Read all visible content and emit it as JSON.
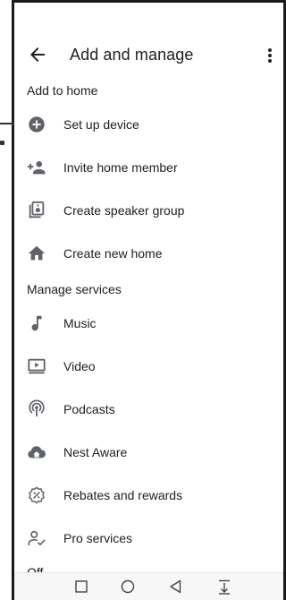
{
  "header": {
    "title": "Add and manage"
  },
  "sections": {
    "add_to_home": "Add to home",
    "manage_services": "Manage services",
    "partial": "Off"
  },
  "add_items": [
    {
      "label": "Set up device",
      "icon": "add-circle-icon"
    },
    {
      "label": "Invite home member",
      "icon": "person-add-icon"
    },
    {
      "label": "Create speaker group",
      "icon": "speaker-group-icon"
    },
    {
      "label": "Create new home",
      "icon": "home-icon"
    }
  ],
  "service_items": [
    {
      "label": "Music",
      "icon": "music-note-icon"
    },
    {
      "label": "Video",
      "icon": "video-icon"
    },
    {
      "label": "Podcasts",
      "icon": "podcast-icon"
    },
    {
      "label": "Nest Aware",
      "icon": "cloud-house-icon"
    },
    {
      "label": "Rebates and rewards",
      "icon": "rebates-icon"
    },
    {
      "label": "Pro services",
      "icon": "pro-services-icon"
    }
  ],
  "colors": {
    "icon": "#5f6368",
    "text": "#202124"
  }
}
